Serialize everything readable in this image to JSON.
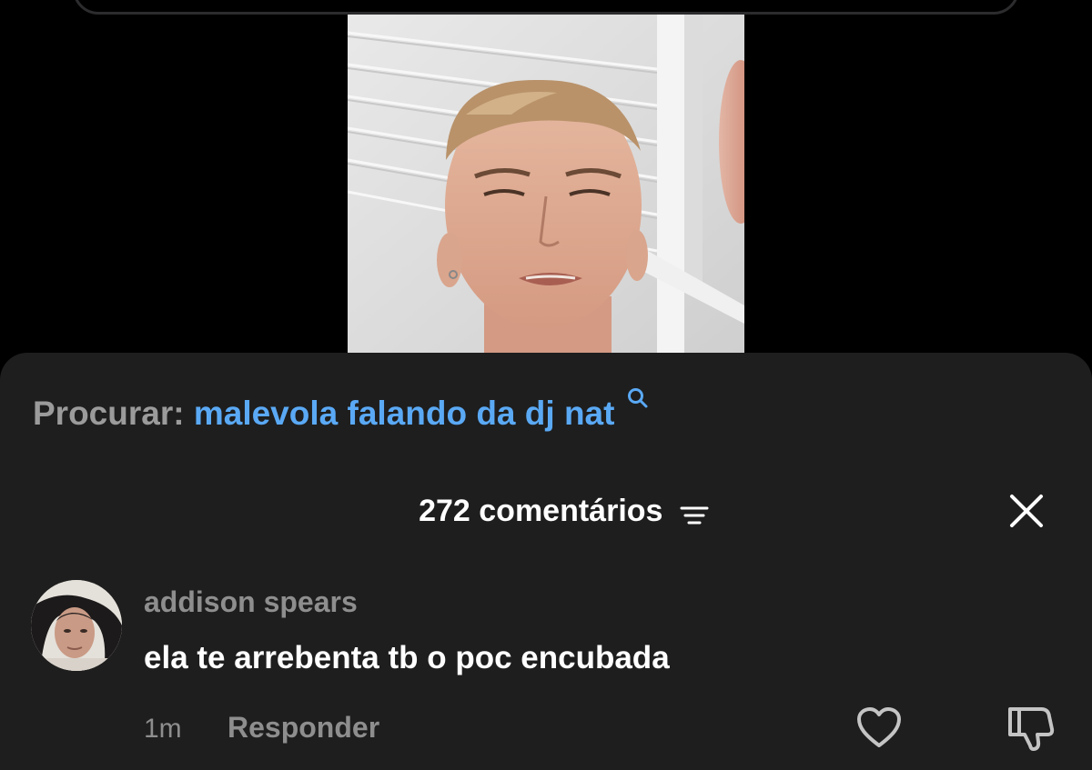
{
  "search": {
    "prefix": "Procurar:",
    "term": "malevola falando da dj nat",
    "icon": "search-icon"
  },
  "comments": {
    "count_label": "272 comentários",
    "filter_icon": "filter-icon",
    "close_icon": "close-icon"
  },
  "comment": {
    "username": "addison spears",
    "text": "ela te arrebenta tb o poc encubada",
    "time": "1m",
    "reply_label": "Responder",
    "like_icon": "heart-icon",
    "dislike_icon": "dislike-icon"
  },
  "colors": {
    "background": "#000000",
    "sheet": "#1e1e1e",
    "accent": "#5aa9f5",
    "muted": "#8e8e8e",
    "text": "#ffffff"
  }
}
